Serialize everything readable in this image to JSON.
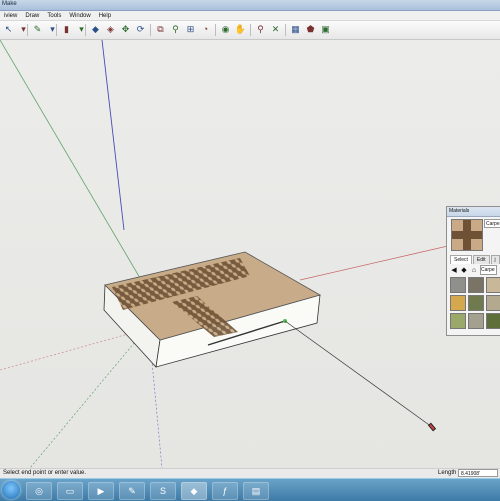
{
  "window": {
    "title": "Make"
  },
  "menu": {
    "items": [
      "iview",
      "Draw",
      "Tools",
      "Window",
      "Help"
    ]
  },
  "toolbar": {
    "tools": [
      {
        "icon": "select-arrow-icon",
        "glyph": "↖"
      },
      {
        "icon": "dropdown-caret-icon",
        "glyph": "▾"
      },
      {
        "icon": "pencil-line-icon",
        "glyph": "✎"
      },
      {
        "icon": "dropdown-caret-icon",
        "glyph": "▾"
      },
      {
        "icon": "eraser-icon",
        "glyph": "▮"
      },
      {
        "icon": "dropdown-caret-icon",
        "glyph": "▾"
      },
      {
        "icon": "push-pull-icon",
        "glyph": "◆"
      },
      {
        "icon": "follow-me-icon",
        "glyph": "◈"
      },
      {
        "icon": "move-icon",
        "glyph": "✥"
      },
      {
        "icon": "rotate-icon",
        "glyph": "⟳"
      },
      {
        "icon": "scale-icon",
        "glyph": "⧉"
      },
      {
        "icon": "tape-measure-icon",
        "glyph": "⚲"
      },
      {
        "icon": "dimension-icon",
        "glyph": "⊞"
      },
      {
        "icon": "protractor-icon",
        "glyph": "◔"
      },
      {
        "icon": "orbit-icon",
        "glyph": "◉"
      },
      {
        "icon": "pan-hand-icon",
        "glyph": "✋"
      },
      {
        "icon": "zoom-icon",
        "glyph": "⚲"
      },
      {
        "icon": "zoom-extents-icon",
        "glyph": "✕"
      },
      {
        "icon": "components-icon",
        "glyph": "▦"
      },
      {
        "icon": "paint-bucket-icon",
        "glyph": "⬟"
      },
      {
        "icon": "warehouse-icon",
        "glyph": "▣"
      }
    ]
  },
  "status": {
    "message": "Select end point or enter value.",
    "length_label": "Length",
    "length_value": "8.41908'"
  },
  "materials_panel": {
    "title": "Materials",
    "name_value": "Carpe",
    "tabs": [
      "Select",
      "Edit",
      "j"
    ],
    "library_value": "Carpe",
    "swatches": [
      "#8f8f8c",
      "#7a7466",
      "#c9b79a",
      "#d4a94d",
      "#6f7a4e",
      "#b3a98e",
      "#9aa86a",
      "#a3a090",
      "#5f6f3a"
    ]
  },
  "colors": {
    "axis_red": "#c56a6a",
    "axis_green": "#5fa36a",
    "axis_blue": "#4a4ab8",
    "carpet": "#c6a987",
    "carpet_pattern": "#7b5d40",
    "box_side": "#f5f5f2"
  },
  "taskbar": {
    "items": [
      {
        "icon": "chrome-icon",
        "glyph": "◎"
      },
      {
        "icon": "explorer-folder-icon",
        "glyph": "▭"
      },
      {
        "icon": "media-player-icon",
        "glyph": "▶"
      },
      {
        "icon": "paint-icon",
        "glyph": "✎"
      },
      {
        "icon": "skype-icon",
        "glyph": "S"
      },
      {
        "icon": "sketchup-icon",
        "glyph": "◆"
      },
      {
        "icon": "flash-icon",
        "glyph": "ƒ"
      },
      {
        "icon": "presentation-icon",
        "glyph": "▤"
      }
    ]
  }
}
